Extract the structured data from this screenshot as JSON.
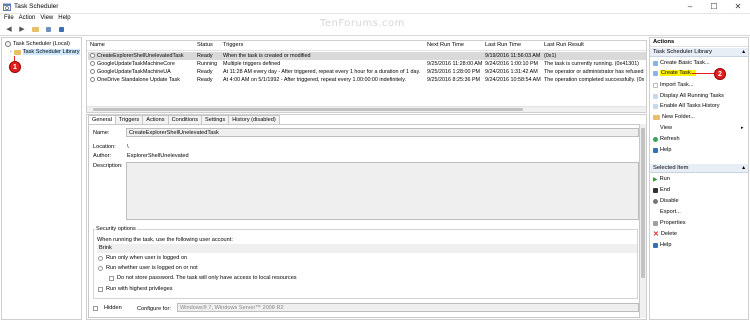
{
  "window": {
    "title": "Task Scheduler",
    "minimize": "–",
    "maximize": "☐",
    "close": "✕"
  },
  "watermark": "TenForums.com",
  "menu": [
    "File",
    "Action",
    "View",
    "Help"
  ],
  "toolbar": {
    "back": "◀",
    "forward": "▶"
  },
  "tree": {
    "root": "Task Scheduler (Local)",
    "library": "Task Scheduler Library",
    "marker": "1"
  },
  "tasks": {
    "columns": [
      "Name",
      "Status",
      "Triggers",
      "Next Run Time",
      "Last Run Time",
      "Last Run Result"
    ],
    "rows": [
      [
        "CreateExplorerShellUnelevatedTask",
        "Ready",
        "When the task is created or modified",
        "",
        "9/19/2016 11:56:03 AM",
        "(0x1)"
      ],
      [
        "GoogleUpdateTaskMachineCore",
        "Running",
        "Multiple triggers defined",
        "9/25/2016 11:28:00 AM",
        "9/24/2016 1:00:10 PM",
        "The task is currently running. (0x41301)"
      ],
      [
        "GoogleUpdateTaskMachineUA",
        "Ready",
        "At 11:28 AM every day - After triggered, repeat every 1 hour for a duration of 1 day.",
        "9/25/2016 1:28:00 PM",
        "9/24/2016 1:31:42 AM",
        "The operator or administrator has refused"
      ],
      [
        "OneDrive Standalone Update Task",
        "Ready",
        "At 4:00 AM on 5/1/1992 - After triggered, repeat every 1.00:00:00 indefinitely.",
        "9/25/2016 8:25:36 PM",
        "9/24/2016 10:58:54 AM",
        "The operation completed successfully. (0x"
      ]
    ]
  },
  "details": {
    "tabs": [
      "General",
      "Triggers",
      "Actions",
      "Conditions",
      "Settings",
      "History (disabled)"
    ],
    "name_label": "Name:",
    "name_value": "CreateExplorerShellUnelevatedTask",
    "location_label": "Location:",
    "location_value": "\\",
    "author_label": "Author:",
    "author_value": "ExplorerShellUnelevated",
    "description_label": "Description:",
    "security_title": "Security options",
    "security_prompt": "When running the task, use the following user account:",
    "user_account": "Brink",
    "opt_logged_on": "Run only when user is logged on",
    "opt_whether": "Run whether user is logged on or not",
    "opt_no_password": "Do not store password.  The task will only have access to local resources",
    "opt_highest": "Run with highest privileges",
    "hidden_label": "Hidden",
    "configure_label": "Configure for:",
    "configure_value": "Windows® 7, Windows Server™ 2008 R2"
  },
  "actions": {
    "title": "Actions",
    "section1": "Task Scheduler Library",
    "items1": [
      "Create Basic Task...",
      "Create Task...",
      "Import Task...",
      "Display All Running Tasks",
      "Enable All Tasks History",
      "New Folder...",
      "View",
      "Refresh",
      "Help"
    ],
    "marker": "2",
    "section2": "Selected Item",
    "items2": [
      "Run",
      "End",
      "Disable",
      "Export...",
      "Properties",
      "Delete",
      "Help"
    ]
  },
  "colors": {
    "marker": "#e02020",
    "highlight": "#fff200",
    "selection": "#cce8ff"
  }
}
